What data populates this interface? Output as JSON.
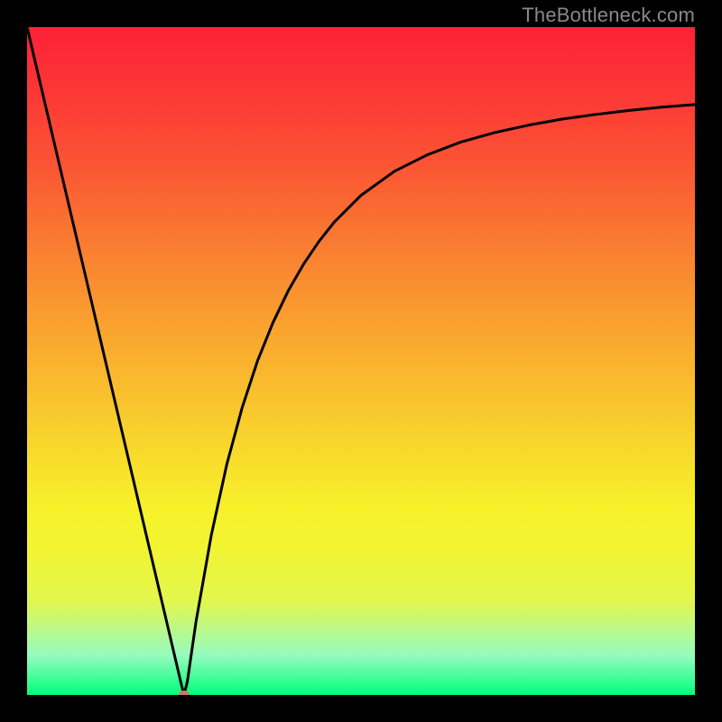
{
  "watermark": {
    "text": "TheBottleneck.com"
  },
  "chart_data": {
    "type": "line",
    "title": "",
    "xlabel": "",
    "ylabel": "",
    "xlim": [
      0,
      100
    ],
    "ylim": [
      0,
      100
    ],
    "grid": false,
    "background_gradient": {
      "stops": [
        {
          "pos": 0.0,
          "color": "#fc2137"
        },
        {
          "pos": 0.1,
          "color": "#fc3836"
        },
        {
          "pos": 0.2,
          "color": "#fb5334"
        },
        {
          "pos": 0.35,
          "color": "#fa8431"
        },
        {
          "pos": 0.5,
          "color": "#f9b22e"
        },
        {
          "pos": 0.62,
          "color": "#f8d52c"
        },
        {
          "pos": 0.72,
          "color": "#f7f12a"
        },
        {
          "pos": 0.78,
          "color": "#f2f432"
        },
        {
          "pos": 0.86,
          "color": "#e2f64e"
        },
        {
          "pos": 0.94,
          "color": "#97fbbe"
        },
        {
          "pos": 1.0,
          "color": "#00ff7d"
        }
      ]
    },
    "series": [
      {
        "name": "bottleneck-curve",
        "color": "#000000",
        "x": [
          0.0,
          2.3,
          4.6,
          6.9,
          9.2,
          11.5,
          13.8,
          16.1,
          18.4,
          20.7,
          23.0,
          23.5,
          24.0,
          25.3,
          27.6,
          29.9,
          32.2,
          34.5,
          36.8,
          39.1,
          41.4,
          43.7,
          46.0,
          50.0,
          55.0,
          60.0,
          65.0,
          70.0,
          75.0,
          80.0,
          85.0,
          90.0,
          95.0,
          100.0
        ],
        "y": [
          100.0,
          90.2,
          80.4,
          70.6,
          60.8,
          51.0,
          41.2,
          31.4,
          21.6,
          11.8,
          2.0,
          0.0,
          2.0,
          11.0,
          24.0,
          34.5,
          43.0,
          50.0,
          55.7,
          60.5,
          64.5,
          67.9,
          70.8,
          74.8,
          78.4,
          80.9,
          82.8,
          84.2,
          85.3,
          86.2,
          86.9,
          87.5,
          88.0,
          88.4
        ]
      }
    ],
    "marker": {
      "x": 23.5,
      "y": 0.0,
      "color": "#cb7a6a",
      "rx": 6,
      "ry": 5
    }
  }
}
